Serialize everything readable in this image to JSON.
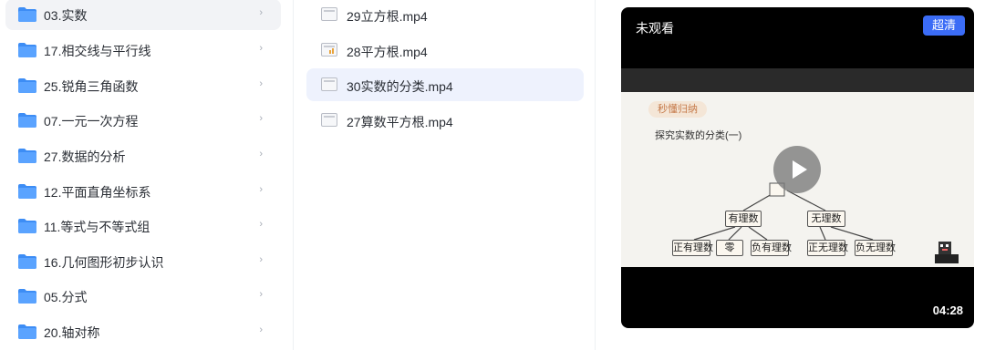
{
  "folders": [
    {
      "label": "03.实数",
      "active": true
    },
    {
      "label": "17.相交线与平行线"
    },
    {
      "label": "25.锐角三角函数"
    },
    {
      "label": "07.一元一次方程"
    },
    {
      "label": "27.数据的分析"
    },
    {
      "label": "12.平面直角坐标系"
    },
    {
      "label": "11.等式与不等式组"
    },
    {
      "label": "16.几何图形初步认识"
    },
    {
      "label": "05.分式"
    },
    {
      "label": "20.轴对称"
    }
  ],
  "chevron_glyph": "›",
  "files": [
    {
      "label": "29立方根.mp4"
    },
    {
      "label": "28平方根.mp4"
    },
    {
      "label": "30实数的分类.mp4",
      "active": true
    },
    {
      "label": "27算数平方根.mp4"
    }
  ],
  "video": {
    "watch_status": "未观看",
    "quality_label": "超清",
    "duration": "04:28",
    "slide": {
      "tag": "秒懂归纳",
      "title": "探究实数的分类(一)",
      "nodes": {
        "rational": "有理数",
        "irrational": "无理数",
        "pos_rational": "正有理数",
        "zero": "零",
        "neg_rational": "负有理数",
        "pos_irrational": "正无理数",
        "neg_irrational": "负无理数"
      }
    }
  },
  "colors": {
    "folder_blue": "#3d8df5",
    "accent_blue": "#3b6cf6",
    "active_file_bg": "#eef2fd",
    "active_folder_bg": "#f2f3f6"
  }
}
